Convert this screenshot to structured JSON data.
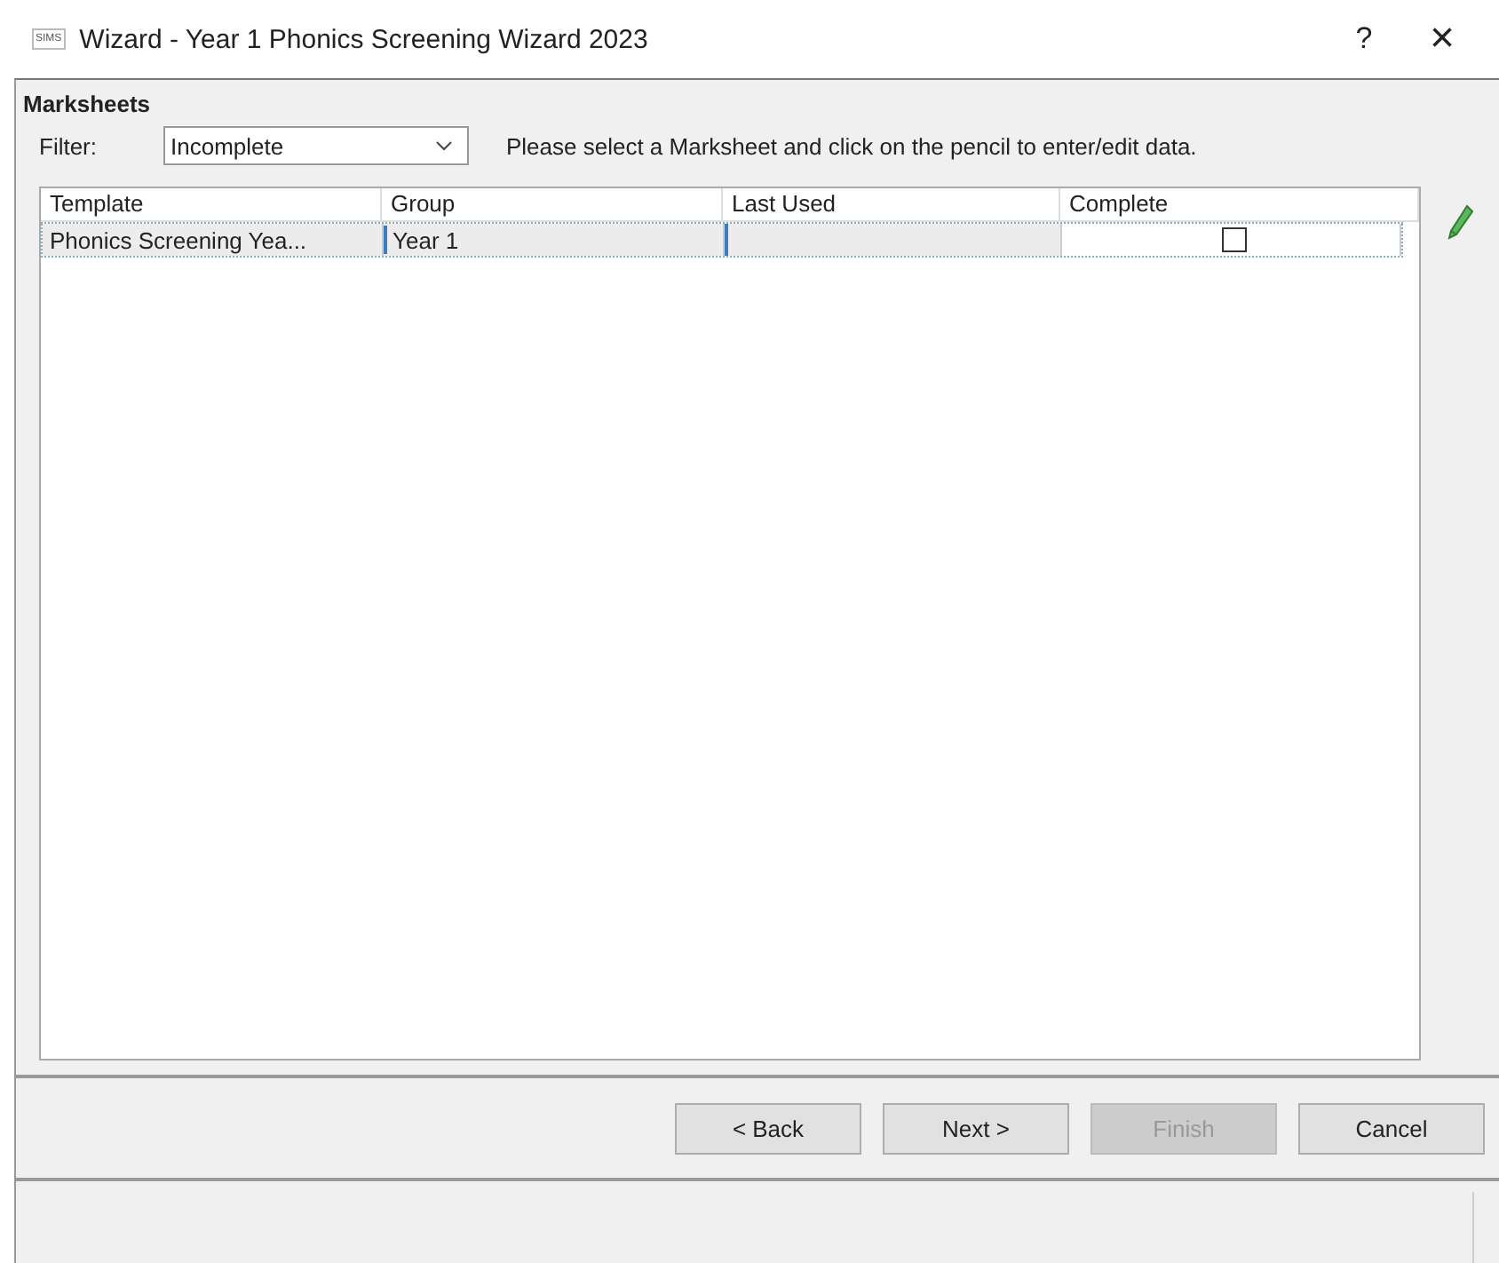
{
  "window": {
    "logo": "SIMS",
    "title": "Wizard - Year 1 Phonics Screening Wizard 2023",
    "help": "?",
    "close": "×"
  },
  "section_title": "Marksheets",
  "filter": {
    "label": "Filter:",
    "value": "Incomplete"
  },
  "instruction": "Please select a Marksheet and click on the pencil to enter/edit data.",
  "table": {
    "columns": [
      "Template",
      "Group",
      "Last Used",
      "Complete"
    ],
    "rows": [
      {
        "template": "Phonics Screening Yea...",
        "group": "Year  1",
        "last_used_editing": true,
        "complete": false,
        "selected": true
      }
    ]
  },
  "buttons": [
    {
      "label": "< Back",
      "disabled": false
    },
    {
      "label": "Next >",
      "disabled": false
    },
    {
      "label": "Finish",
      "disabled": true
    },
    {
      "label": "Cancel",
      "disabled": false
    }
  ]
}
